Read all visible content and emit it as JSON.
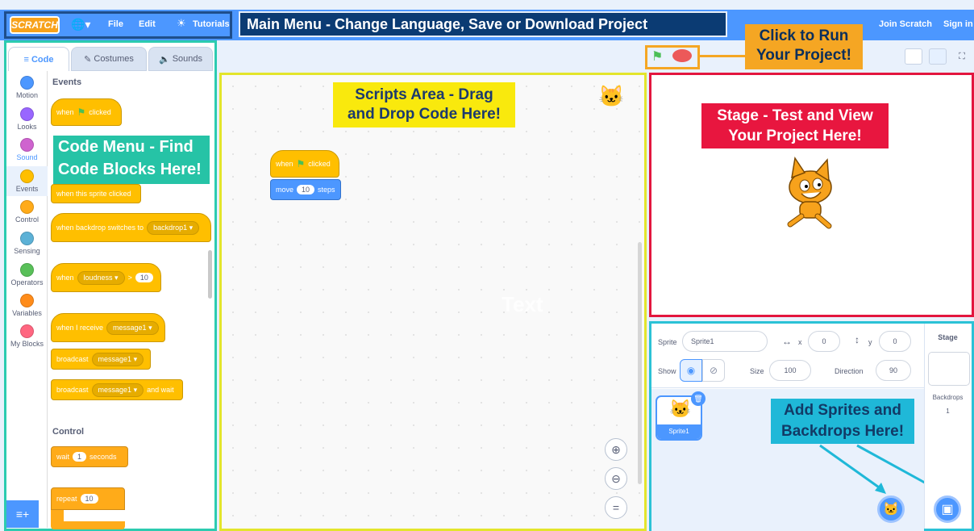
{
  "menu": {
    "logo": "SCRATCH",
    "language_icon": "globe-icon",
    "file": "File",
    "edit": "Edit",
    "tutorials": "Tutorials",
    "join": "Join Scratch",
    "signin": "Sign in"
  },
  "callouts": {
    "main_menu": "Main Menu - Change Language, Save or Download Project",
    "run_line1": "Click to Run",
    "run_line2": "Your Project!",
    "scripts_line1": "Scripts Area - Drag",
    "scripts_line2": "and Drop Code Here!",
    "code_line1": "Code Menu - Find",
    "code_line2": "Code Blocks Here!",
    "stage_line1": "Stage - Test and View",
    "stage_line2": "Your Project Here!",
    "sprites_line1": "Add Sprites and",
    "sprites_line2": "Backdrops Here!",
    "watermark": "Text"
  },
  "tabs": {
    "code": "Code",
    "costumes": "Costumes",
    "sounds": "Sounds"
  },
  "categories": [
    {
      "label": "Motion",
      "color": "#4c97ff"
    },
    {
      "label": "Looks",
      "color": "#9966ff"
    },
    {
      "label": "Sound",
      "color": "#cf63cf"
    },
    {
      "label": "Events",
      "color": "#ffbf00"
    },
    {
      "label": "Control",
      "color": "#ffab19"
    },
    {
      "label": "Sensing",
      "color": "#5cb1d6"
    },
    {
      "label": "Operators",
      "color": "#59c059"
    },
    {
      "label": "Variables",
      "color": "#ff8c1a"
    },
    {
      "label": "My Blocks",
      "color": "#ff6680"
    }
  ],
  "palette": {
    "events_title": "Events",
    "when_flag": "when",
    "clicked": "clicked",
    "when_sprite_clicked": "when this sprite clicked",
    "when_backdrop": "when backdrop switches to",
    "backdrop1": "backdrop1",
    "when": "when",
    "loudness": "loudness",
    "gt": ">",
    "ten": "10",
    "when_receive": "when I receive",
    "message1": "message1",
    "broadcast": "broadcast",
    "and_wait": "and wait",
    "control_title": "Control",
    "wait": "wait",
    "one": "1",
    "seconds": "seconds",
    "repeat": "repeat",
    "repeat_val": "10"
  },
  "script": {
    "hat": "when",
    "clicked": "clicked",
    "move": "move",
    "steps_val": "10",
    "steps": "steps"
  },
  "sprite_info": {
    "sprite_label": "Sprite",
    "sprite_name": "Sprite1",
    "x_label": "x",
    "x_val": "0",
    "y_label": "y",
    "y_val": "0",
    "show_label": "Show",
    "size_label": "Size",
    "size_val": "100",
    "direction_label": "Direction",
    "direction_val": "90",
    "thumb_name": "Sprite1",
    "stage_label": "Stage",
    "backdrops_label": "Backdrops",
    "backdrops_count": "1"
  },
  "colors": {
    "menu_blue": "#4c97ff",
    "events": "#ffbf00",
    "motion": "#4c97ff"
  }
}
